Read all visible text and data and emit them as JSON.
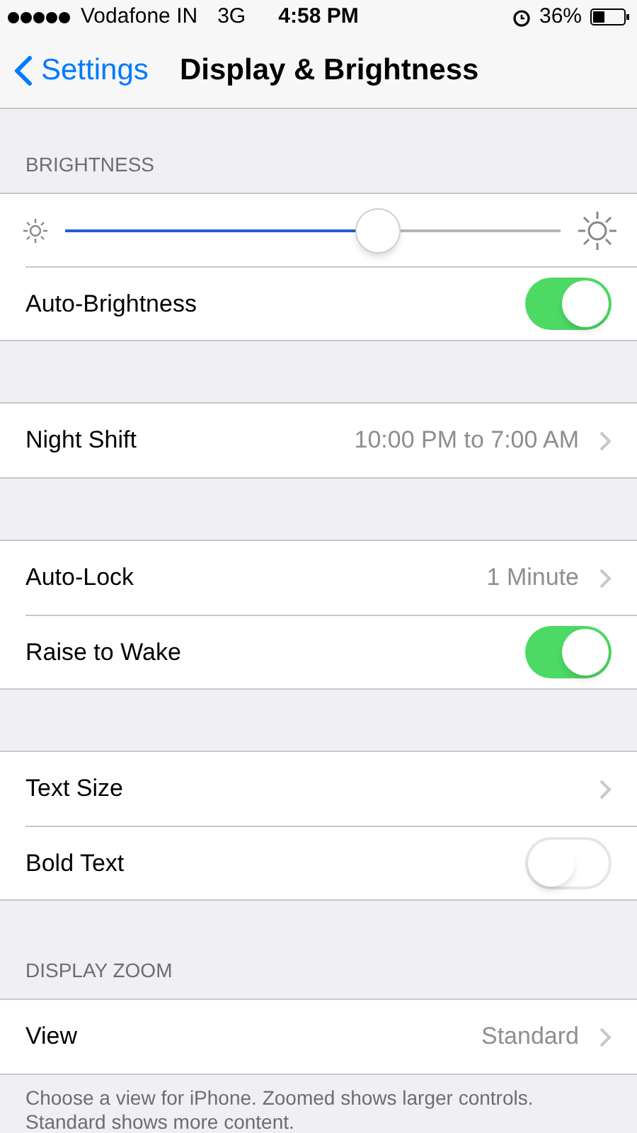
{
  "status_bar": {
    "carrier": "Vodafone IN",
    "network": "3G",
    "time": "4:58 PM",
    "battery": "36%"
  },
  "nav": {
    "back": "Settings",
    "title": "Display & Brightness"
  },
  "sections": [
    {
      "header": "BRIGHTNESS",
      "rows": [
        {
          "kind": "slider",
          "level": 0.63
        },
        {
          "kind": "toggle",
          "label": "Auto-Brightness",
          "on": true
        }
      ]
    },
    {
      "rows": [
        {
          "kind": "link",
          "label": "Night Shift",
          "value": "10:00 PM to 7:00 AM"
        }
      ]
    },
    {
      "rows": [
        {
          "kind": "link",
          "label": "Auto-Lock",
          "value": "1 Minute"
        },
        {
          "kind": "toggle",
          "label": "Raise to Wake",
          "on": true
        }
      ]
    },
    {
      "rows": [
        {
          "kind": "link",
          "label": "Text Size"
        },
        {
          "kind": "toggle",
          "label": "Bold Text",
          "on": false
        }
      ]
    },
    {
      "header": "DISPLAY ZOOM",
      "rows": [
        {
          "kind": "link",
          "label": "View",
          "value": "Standard"
        }
      ],
      "footer": "Choose a view for iPhone. Zoomed shows larger controls. Standard shows more content."
    }
  ]
}
